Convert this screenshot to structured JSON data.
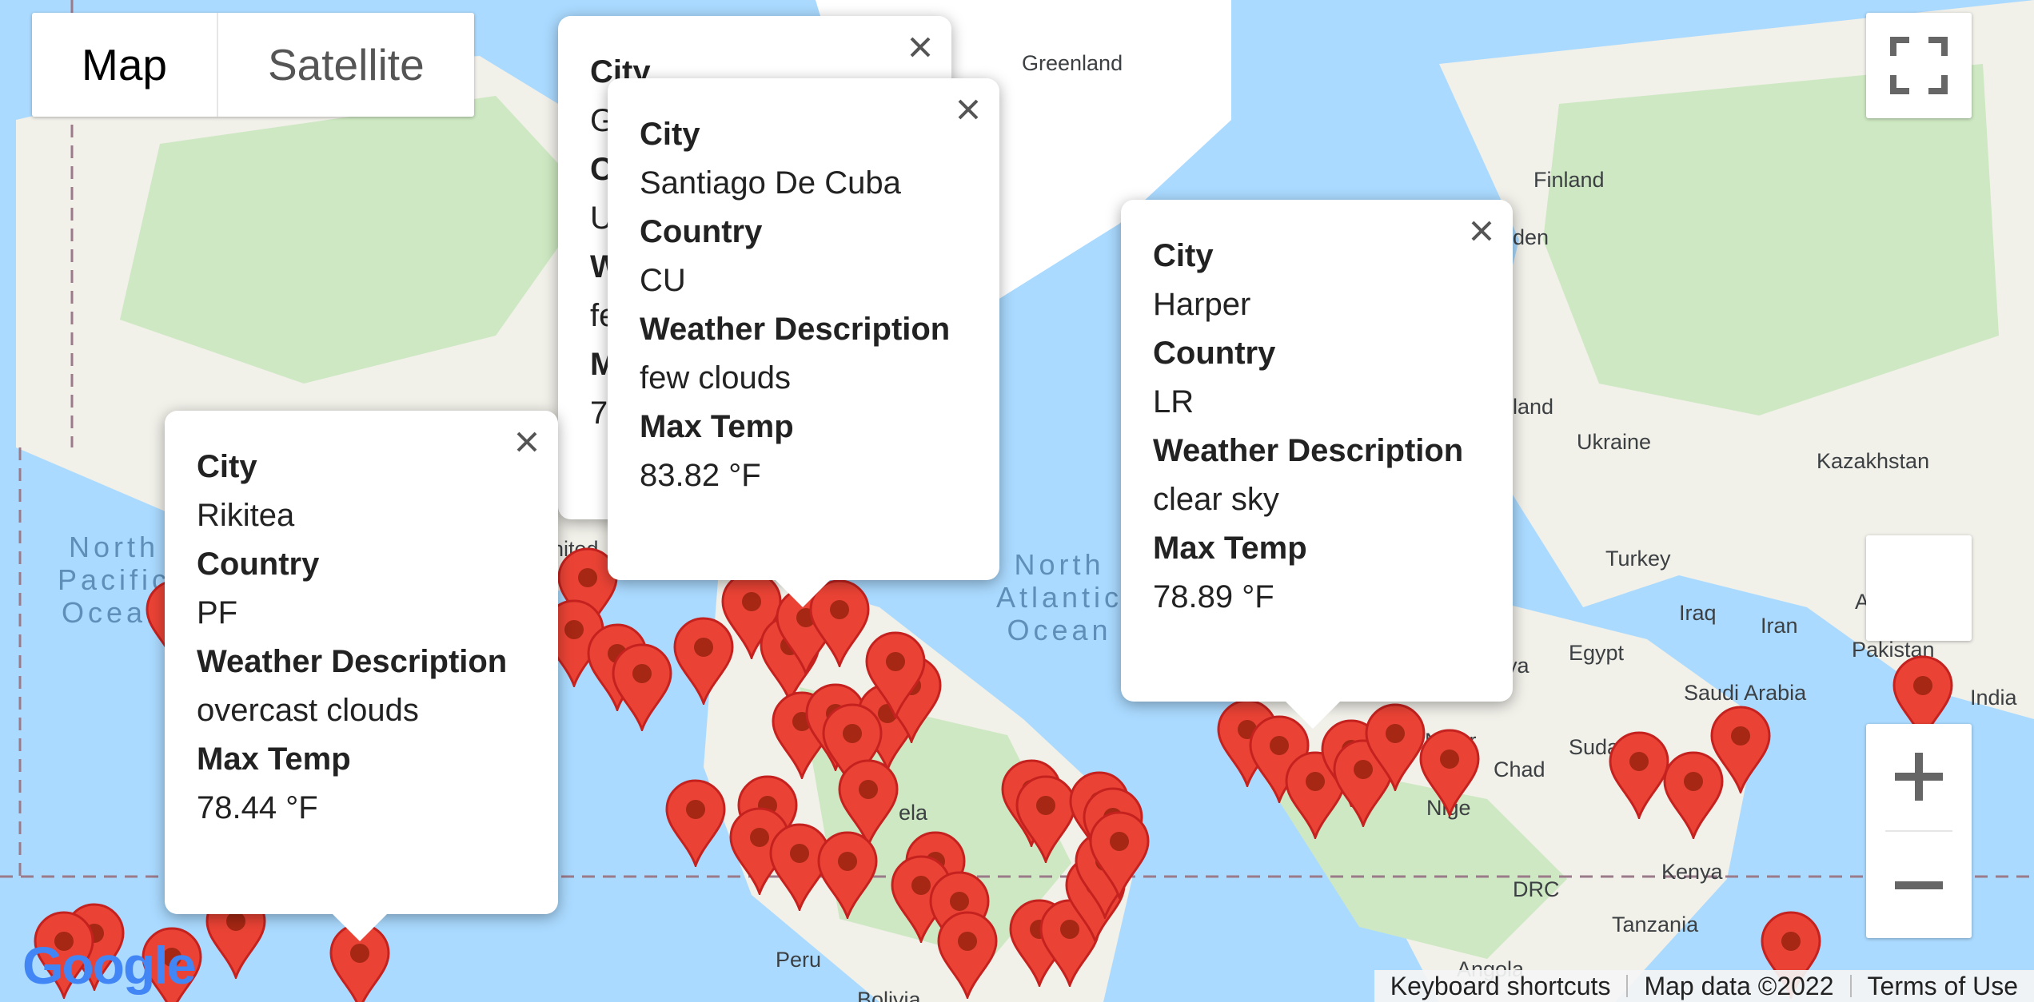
{
  "map_type_control": {
    "map_label": "Map",
    "satellite_label": "Satellite",
    "selected": "Map"
  },
  "labels": {
    "countries": [
      "Greenland",
      "Finland",
      "Ukraine",
      "Kazakhstan",
      "Turkey",
      "Iraq",
      "Iran",
      "Afgh",
      "Pakistan",
      "India",
      "Egypt",
      "Saudi Arabia",
      "Chad",
      "Niger",
      "Sudan",
      "Kenya",
      "DRC",
      "Tanzania",
      "Angola",
      "Peru",
      "Bolivia",
      "ya",
      "Nige",
      "ela",
      "nited",
      "land",
      "den"
    ],
    "oceans": [
      "North\nPacific\nOcean",
      "North\nAtlantic\nOcean"
    ]
  },
  "infowindows": [
    {
      "city_label": "City",
      "city": "Rikitea",
      "country_label": "Country",
      "country": "PF",
      "weather_label": "Weather Description",
      "weather": "overcast clouds",
      "temp_label": "Max Temp",
      "temp": "78.44 °F"
    },
    {
      "city_label": "City",
      "city": "Santiago De Cuba",
      "country_label": "Country",
      "country": "CU",
      "weather_label": "Weather Description",
      "weather": "few clouds",
      "temp_label": "Max Temp",
      "temp": "83.82 °F"
    },
    {
      "city_label": "City",
      "city": "Harper",
      "country_label": "Country",
      "country": "LR",
      "weather_label": "Weather Description",
      "weather": "clear sky",
      "temp_label": "Max Temp",
      "temp": "78.89 °F"
    },
    {
      "city_label": "City",
      "city": "G",
      "country_label": "C",
      "country": "U",
      "weather_label": "W",
      "weather": "fe",
      "temp_label": "M",
      "temp": "7"
    }
  ],
  "controls": {
    "fullscreen_icon": "fullscreen-icon",
    "zoom_in_icon": "zoom-in-icon",
    "zoom_out_icon": "zoom-out-icon"
  },
  "attribution": {
    "keyboard": "Keyboard shortcuts",
    "data": "Map data ©2022",
    "terms": "Terms of Use"
  },
  "logo": "Google",
  "colors": {
    "water": "#aadaff",
    "land": "#f1f0e9",
    "green": "#cde8c2",
    "marker": "#ea4335",
    "marker_dot": "#a52714"
  }
}
